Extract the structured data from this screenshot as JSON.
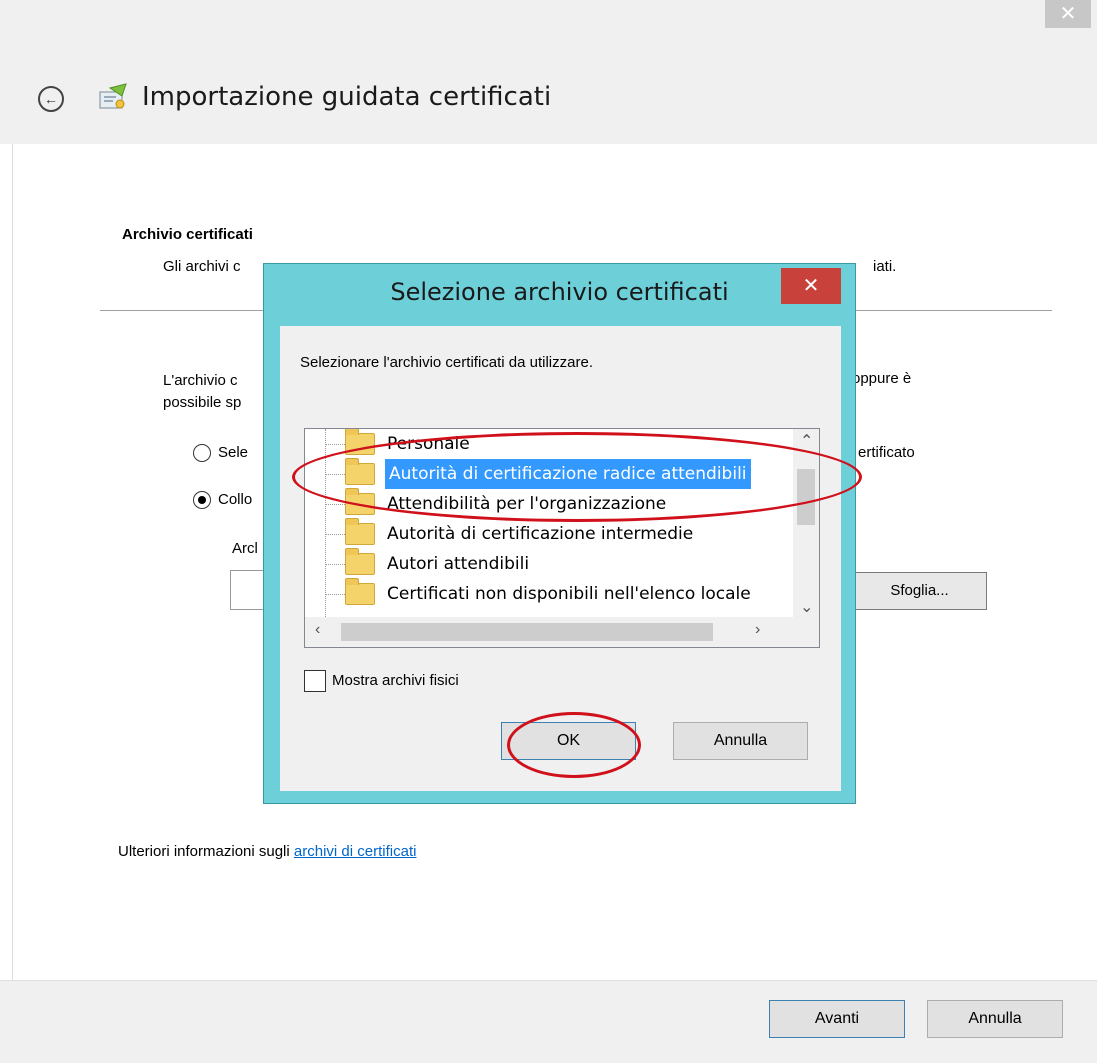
{
  "wizard": {
    "title": "Importazione guidata certificati",
    "close_label": "✕",
    "back_label": "←",
    "section_title": "Archivio certificati",
    "section_desc_start": "Gli archivi c",
    "section_desc_end": "iati.",
    "para1_start": "L'archivio c",
    "para1_line2": "possibile sp",
    "para1_tail": "oppure è",
    "radio_auto_label": "Sele",
    "radio_auto_tail": "ertificato",
    "radio_manual_label": "Collo",
    "path_label": "Arcl",
    "browse_label": "Sfoglia...",
    "more_info_text": "Ulteriori informazioni sugli ",
    "more_info_link": "archivi di certificati",
    "next_label": "Avanti",
    "cancel_label": "Annulla"
  },
  "dialog": {
    "title": "Selezione archivio certificati",
    "close_label": "✕",
    "prompt": "Selezionare l'archivio certificati da utilizzare.",
    "stores": [
      {
        "label": "Personale"
      },
      {
        "label": "Autorità di certificazione radice attendibili"
      },
      {
        "label": "Attendibilità per l'organizzazione"
      },
      {
        "label": "Autorità di certificazione intermedie"
      },
      {
        "label": "Autori attendibili"
      },
      {
        "label": "Certificati non disponibili nell'elenco locale"
      }
    ],
    "selected_index": 1,
    "show_physical_label": "Mostra archivi fisici",
    "ok_label": "OK",
    "cancel_label": "Annulla"
  },
  "colors": {
    "dialog_frame": "#6dd0d9",
    "close_red": "#c8413a",
    "selection_blue": "#3399ff",
    "annotation_red": "#d0101a",
    "link_blue": "#0066cc"
  }
}
